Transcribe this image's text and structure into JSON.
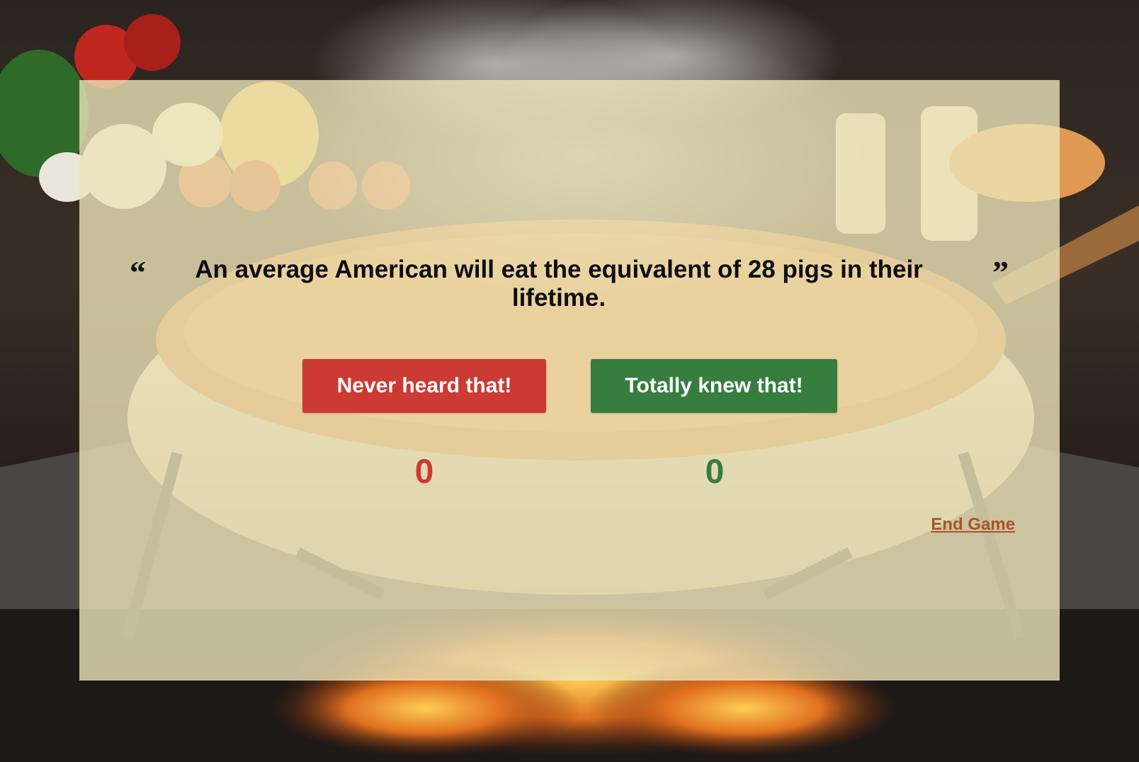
{
  "quiz": {
    "open_quote": "“",
    "close_quote": "”",
    "fact": "An average American will eat the equivalent of 28 pigs in their lifetime.",
    "never_label": "Never heard that!",
    "knew_label": "Totally knew that!",
    "never_count": "0",
    "knew_count": "0",
    "end_game_label": "End Game"
  },
  "colors": {
    "panel": "#ece4b8",
    "never_red": "#cb3a33",
    "knew_green": "#367d3e",
    "end_game_link": "#a9542a",
    "text_dark": "#0d0d0d"
  },
  "icons": {
    "open_quote": "left-double-quote",
    "close_quote": "right-double-quote"
  }
}
